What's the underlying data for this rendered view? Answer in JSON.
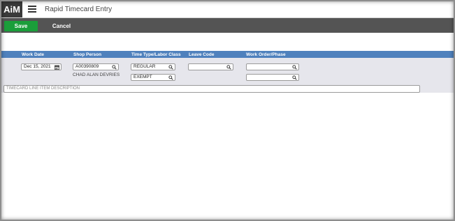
{
  "app": {
    "logo": "AiM",
    "title": "Rapid Timecard Entry"
  },
  "toolbar": {
    "save_label": "Save",
    "cancel_label": "Cancel"
  },
  "columns": {
    "work_date": "Work Date",
    "shop_person": "Shop Person",
    "time_type": "Time Type/Labor Class",
    "leave_code": "Leave Code",
    "work_order": "Work Order/Phase"
  },
  "form": {
    "work_date_value": "Dec 15, 2021",
    "shop_person_value": "A00390809",
    "shop_person_name": "CHAD ALAN DEVRIES",
    "time_type_value": "REGULAR",
    "labor_class_value": "EXEMPT",
    "leave_code_value": "",
    "work_order_value": "",
    "phase_value": "",
    "description_placeholder": "TIMECARD LINE ITEM DESCRIPTION"
  },
  "colors": {
    "header_blue": "#4f81bd",
    "save_green": "#1a9e3a",
    "action_bar": "#545454"
  },
  "icons": [
    "menu-icon",
    "calendar-icon",
    "search-icon"
  ]
}
